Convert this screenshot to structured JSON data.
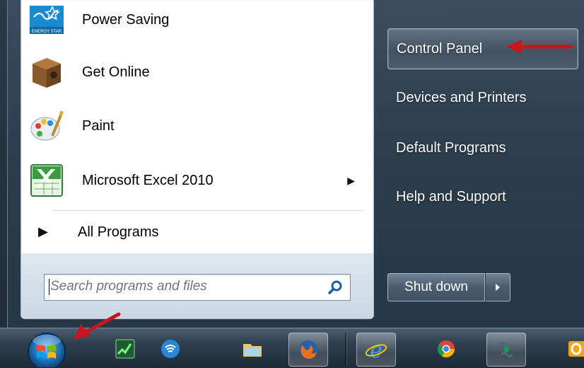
{
  "start_menu": {
    "programs": [
      {
        "label": "Power Saving",
        "icon": "energy-star-icon",
        "has_submenu": false
      },
      {
        "label": "Get Online",
        "icon": "box-icon",
        "has_submenu": false
      },
      {
        "label": "Paint",
        "icon": "paint-palette-icon",
        "has_submenu": false
      },
      {
        "label": "Microsoft Excel 2010",
        "icon": "excel-icon",
        "has_submenu": true
      }
    ],
    "all_programs_label": "All Programs",
    "search": {
      "placeholder": "Search programs and files",
      "value": ""
    },
    "right_items": [
      {
        "label": "Control Panel",
        "highlighted": true
      },
      {
        "label": "Devices and Printers",
        "highlighted": false
      },
      {
        "label": "Default Programs",
        "highlighted": false
      },
      {
        "label": "Help and Support",
        "highlighted": false
      }
    ],
    "shutdown_label": "Shut down"
  },
  "energy_star_text": "ENERGY STAR",
  "taskbar": {
    "icons": [
      "start-orb-icon",
      "stock-chart-icon",
      "wireless-icon",
      "file-explorer-icon",
      "firefox-icon",
      "internet-explorer-icon",
      "chrome-icon",
      "network-tool-icon",
      "outlook-icon"
    ]
  },
  "colors": {
    "annotation_red": "#c8161d",
    "menu_glass": "#2c3d4c",
    "left_panel": "#ffffff"
  }
}
